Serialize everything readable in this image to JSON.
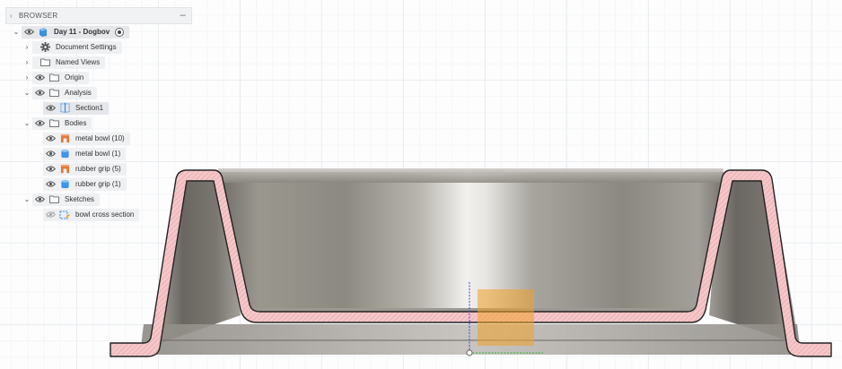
{
  "browser": {
    "title": "BROWSER",
    "collapse_glyph": "‹",
    "minimize_glyph": "–",
    "items": [
      {
        "label": "Day 11 - Dogbov",
        "icon": "document-component-icon",
        "expanded": true,
        "visible": true,
        "active_radio": true
      },
      {
        "label": "Document Settings",
        "icon": "gear-icon",
        "expanded": false
      },
      {
        "label": "Named Views",
        "icon": "folder-icon",
        "expanded": false
      },
      {
        "label": "Origin",
        "icon": "folder-icon",
        "expanded": false,
        "visible": true
      },
      {
        "label": "Analysis",
        "icon": "folder-icon",
        "expanded": true,
        "visible": true
      },
      {
        "label": "Section1",
        "icon": "section-analysis-icon",
        "visible": true
      },
      {
        "label": "Bodies",
        "icon": "folder-icon",
        "expanded": true,
        "visible": true
      },
      {
        "label": "metal bowl (10)",
        "icon": "body-orange-icon",
        "visible": true
      },
      {
        "label": "metal bowl (1)",
        "icon": "body-blue-icon",
        "visible": true
      },
      {
        "label": "rubber grip (5)",
        "icon": "body-orange-icon",
        "visible": true
      },
      {
        "label": "rubber grip (1)",
        "icon": "body-blue-icon",
        "visible": true
      },
      {
        "label": "Sketches",
        "icon": "folder-icon",
        "expanded": true,
        "visible": true
      },
      {
        "label": "bowl cross section",
        "icon": "sketch-icon",
        "visible": false
      }
    ]
  },
  "colors": {
    "section_fill": "#f4c7c9",
    "section_edge": "#2a2a2a",
    "metal_light": "#dcdad7",
    "metal_dark": "#7d7a74",
    "gizmo_orange": "#f0a028",
    "axis_blue": "#3b46d6",
    "axis_green": "#2fb02f"
  }
}
